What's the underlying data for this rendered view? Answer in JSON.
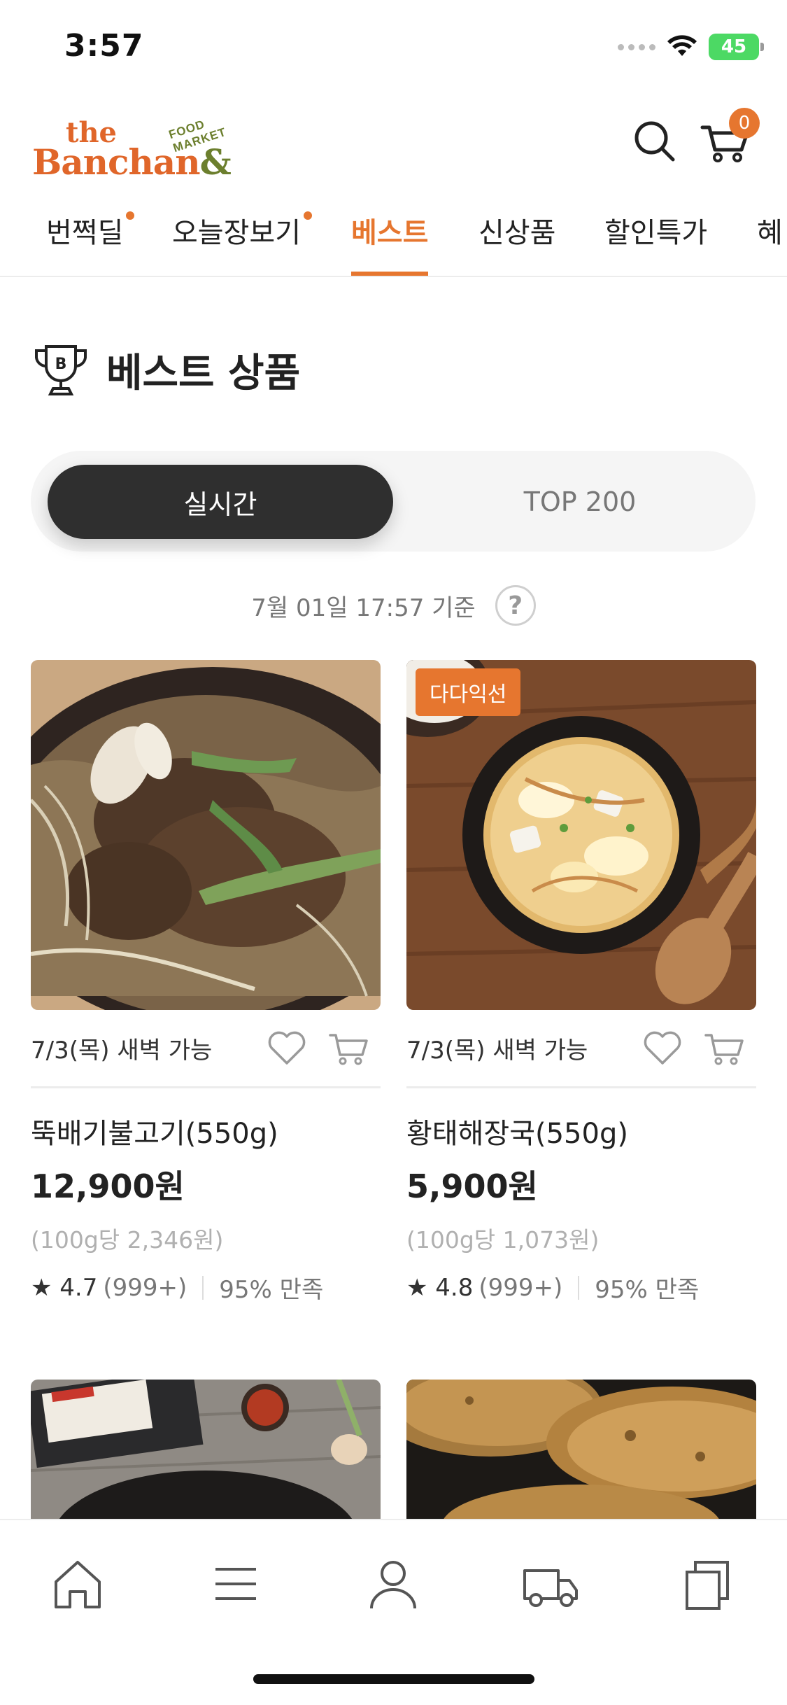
{
  "status_bar": {
    "time": "3:57",
    "battery": "45"
  },
  "header": {
    "logo_the": "the",
    "logo_banchan": "Banchan",
    "logo_amp": "&",
    "logo_food_market": "FOOD MARKET",
    "cart_count": "0"
  },
  "nav_tabs": [
    {
      "label": "번쩍딜",
      "dot": true
    },
    {
      "label": "오늘장보기",
      "dot": true
    },
    {
      "label": "베스트",
      "active": true
    },
    {
      "label": "신상품"
    },
    {
      "label": "할인특가"
    },
    {
      "label": "혜"
    }
  ],
  "section": {
    "title": "베스트 상품",
    "trophy_letter": "B"
  },
  "toggle": {
    "active": "실시간",
    "inactive": "TOP 200"
  },
  "timestamp": {
    "text": "7월 01일 17:57 기준",
    "help": "?"
  },
  "products": [
    {
      "badge": "",
      "delivery": "7/3(목) 새벽 가능",
      "name": "뚝배기불고기(550g)",
      "price": "12,900원",
      "unit_price": "(100g당 2,346원)",
      "rating": "4.7",
      "review_count": "(999+)",
      "satisfaction": "95% 만족"
    },
    {
      "badge": "다다익선",
      "delivery": "7/3(목) 새벽 가능",
      "name": "황태해장국(550g)",
      "price": "5,900원",
      "unit_price": "(100g당 1,073원)",
      "rating": "4.8",
      "review_count": "(999+)",
      "satisfaction": "95% 만족"
    }
  ],
  "colors": {
    "accent": "#e6762f",
    "logo_orange": "#e0662a",
    "logo_green": "#6c7f2e",
    "toggle_dark": "#2f2f2f"
  },
  "icons": [
    "search-icon",
    "cart-icon",
    "trophy-icon",
    "help-icon",
    "heart-icon",
    "home-icon",
    "menu-icon",
    "user-icon",
    "truck-icon",
    "recent-icon"
  ]
}
